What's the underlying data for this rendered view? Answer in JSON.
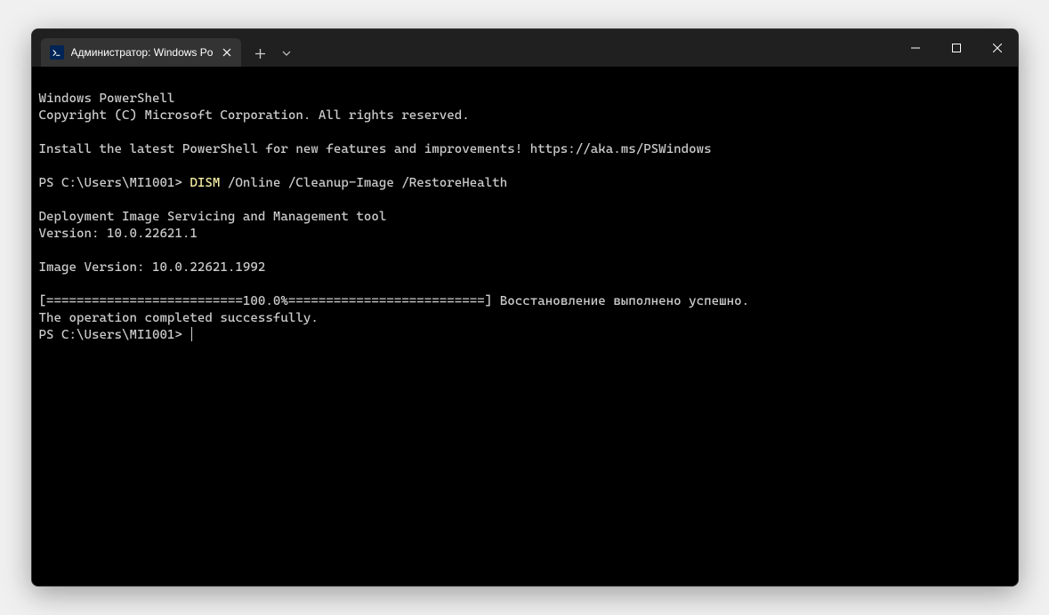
{
  "titlebar": {
    "tab_title": "Администратор: Windows Po"
  },
  "terminal": {
    "header1": "Windows PowerShell",
    "header2": "Copyright (C) Microsoft Corporation. All rights reserved.",
    "install_msg": "Install the latest PowerShell for new features and improvements! https://aka.ms/PSWindows",
    "prompt1": "PS C:\\Users\\MI1001> ",
    "cmd_dism": "DISM",
    "cmd_args": " /Online /Cleanup-Image /RestoreHealth",
    "dism_title": "Deployment Image Servicing and Management tool",
    "dism_version": "Version: 10.0.22621.1",
    "image_version": "Image Version: 10.0.22621.1992",
    "progress_line": "[==========================100.0%==========================] Восстановление выполнено успешно.",
    "completed": "The operation completed successfully.",
    "prompt2": "PS C:\\Users\\MI1001> "
  }
}
